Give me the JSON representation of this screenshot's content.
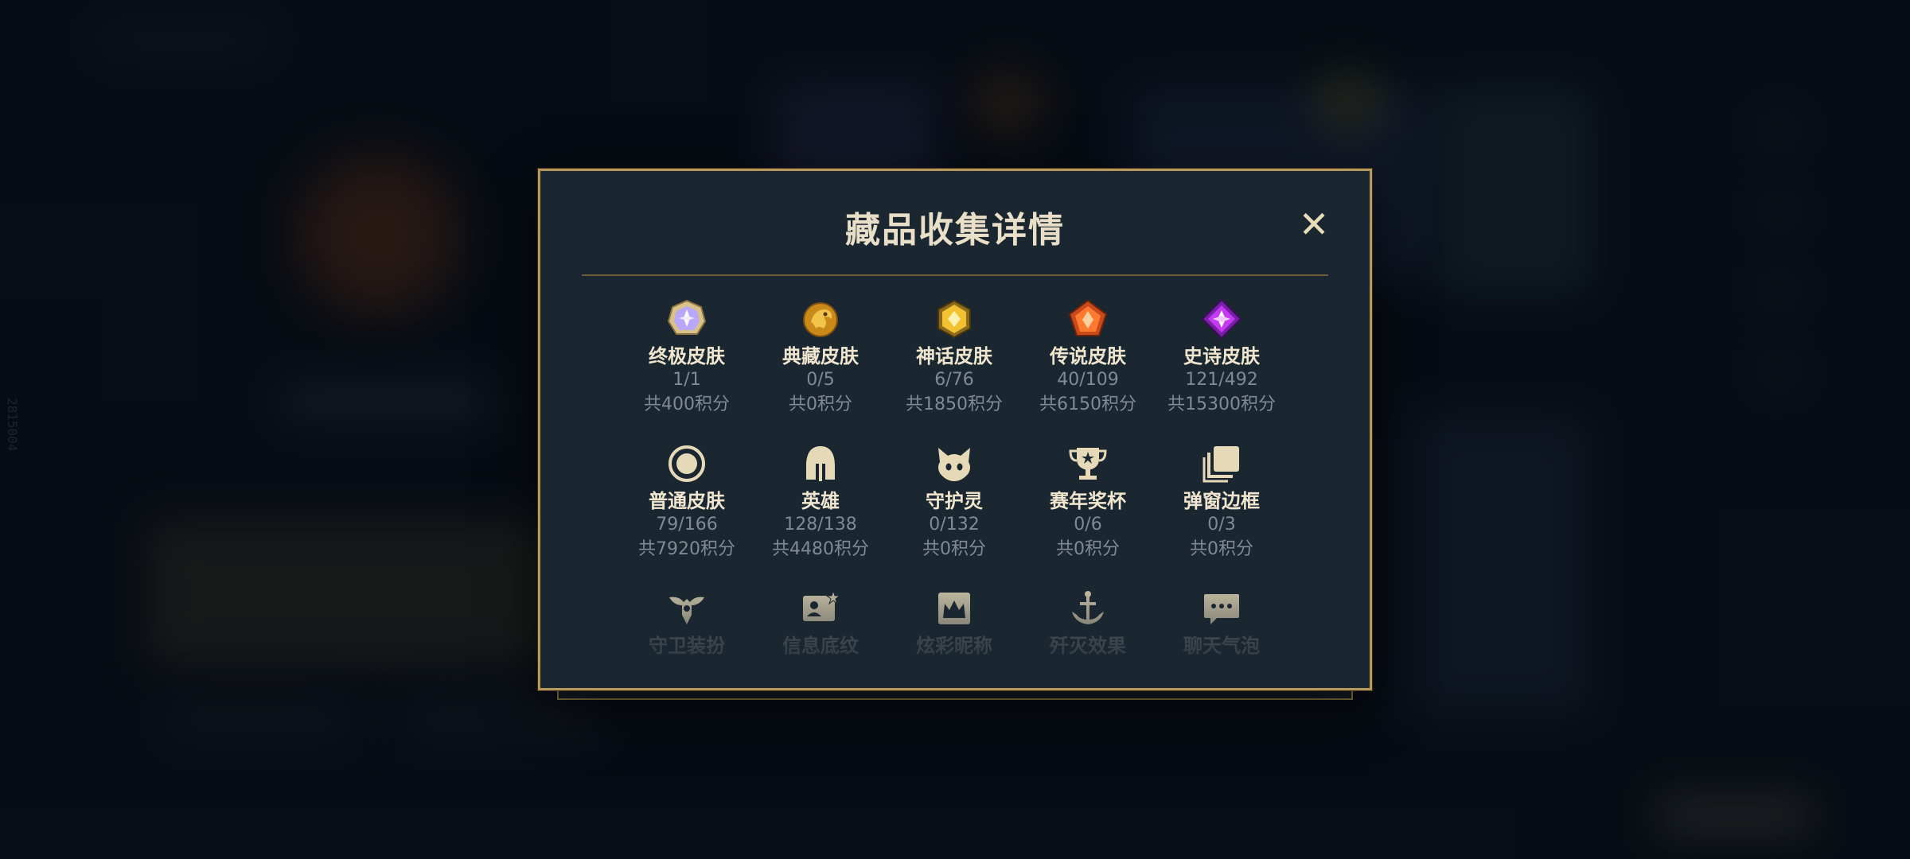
{
  "background": {
    "vertical_id": "2815004"
  },
  "modal": {
    "title": "藏品收集详情",
    "close_icon": "close-icon"
  },
  "items": [
    {
      "icon": "ultimate-skin-gem-icon",
      "label": "终极皮肤",
      "count": "1/1",
      "points": "共400积分"
    },
    {
      "icon": "treasured-skin-dragon-icon",
      "label": "典藏皮肤",
      "count": "0/5",
      "points": "共0积分"
    },
    {
      "icon": "mythic-skin-gem-icon",
      "label": "神话皮肤",
      "count": "6/76",
      "points": "共1850积分"
    },
    {
      "icon": "legendary-skin-gem-icon",
      "label": "传说皮肤",
      "count": "40/109",
      "points": "共6150积分"
    },
    {
      "icon": "epic-skin-gem-icon",
      "label": "史诗皮肤",
      "count": "121/492",
      "points": "共15300积分"
    },
    {
      "icon": "normal-skin-ring-icon",
      "label": "普通皮肤",
      "count": "79/166",
      "points": "共7920积分"
    },
    {
      "icon": "hero-helmet-icon",
      "label": "英雄",
      "count": "128/138",
      "points": "共4480积分"
    },
    {
      "icon": "guardian-spirit-icon",
      "label": "守护灵",
      "count": "0/132",
      "points": "共0积分"
    },
    {
      "icon": "season-trophy-icon",
      "label": "赛年奖杯",
      "count": "0/6",
      "points": "共0积分"
    },
    {
      "icon": "popup-frame-icon",
      "label": "弹窗边框",
      "count": "0/3",
      "points": "共0积分"
    },
    {
      "icon": "guard-outfit-icon",
      "label": "守卫装扮",
      "count": "",
      "points": ""
    },
    {
      "icon": "info-card-icon",
      "label": "信息底纹",
      "count": "",
      "points": ""
    },
    {
      "icon": "flashy-nickname-icon",
      "label": "炫彩昵称",
      "count": "",
      "points": ""
    },
    {
      "icon": "annihilation-effect-icon",
      "label": "歼灭效果",
      "count": "",
      "points": ""
    },
    {
      "icon": "chat-bubble-icon",
      "label": "聊天气泡",
      "count": "",
      "points": ""
    }
  ],
  "colors": {
    "modal_bg": "#1b2730",
    "gold_border": "#b7975a",
    "title": "#e9dfc8",
    "muted": "#7f8a93"
  }
}
